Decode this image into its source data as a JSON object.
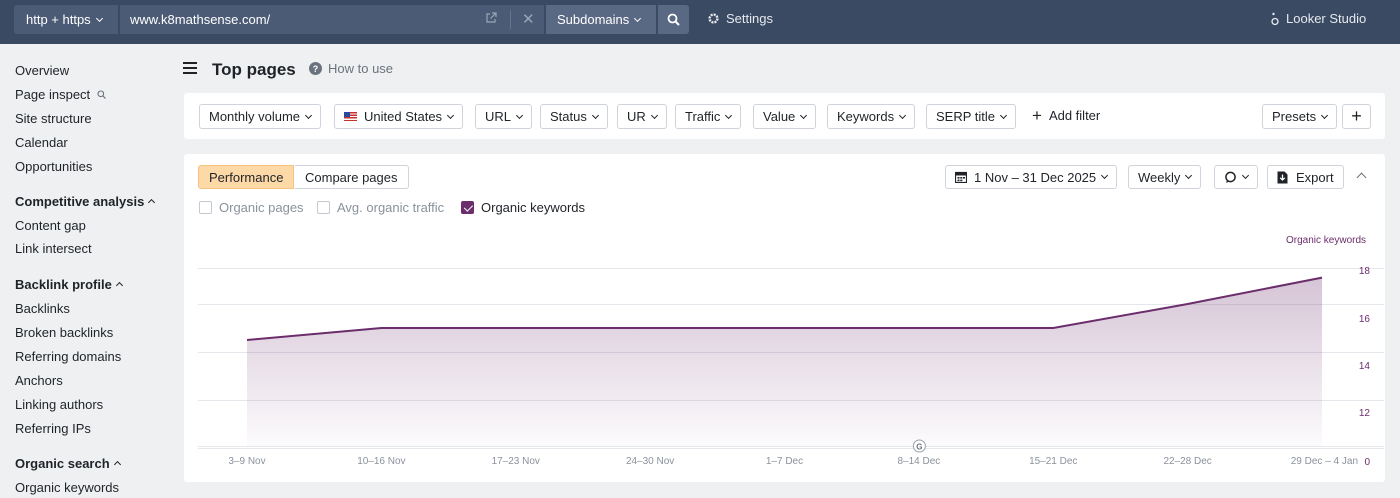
{
  "topbar": {
    "protocol": "http + https",
    "url": "www.k8mathsense.com/",
    "mode": "Subdomains",
    "settings_label": "Settings",
    "looker_label": "Looker Studio"
  },
  "sidebar": {
    "items_top": [
      "Overview",
      "Page inspect",
      "Site structure",
      "Calendar",
      "Opportunities"
    ],
    "competitive_head": "Competitive analysis",
    "competitive_items": [
      "Content gap",
      "Link intersect"
    ],
    "backlink_head": "Backlink profile",
    "backlink_items": [
      "Backlinks",
      "Broken backlinks",
      "Referring domains",
      "Anchors",
      "Linking authors",
      "Referring IPs"
    ],
    "organic_head": "Organic search",
    "organic_items": [
      "Organic keywords"
    ]
  },
  "header": {
    "title": "Top pages",
    "how_to": "How to use"
  },
  "filters": {
    "items": [
      "Monthly volume",
      "United States",
      "URL",
      "Status",
      "UR",
      "Traffic",
      "Value",
      "Keywords",
      "SERP title"
    ],
    "add_filter": "Add filter",
    "presets": "Presets",
    "plus": "+"
  },
  "panel": {
    "tab_performance": "Performance",
    "tab_compare": "Compare pages",
    "date_range": "1 Nov – 31 Dec 2025",
    "interval": "Weekly",
    "export": "Export",
    "legend": [
      "Organic pages",
      "Avg. organic traffic",
      "Organic keywords"
    ],
    "legend_checked": [
      false,
      false,
      true
    ]
  },
  "colors": {
    "accent": "#6b2d6b",
    "topbar": "#3a4a63",
    "active_tab": "#fdd9a8"
  },
  "chart_data": {
    "type": "area",
    "series": [
      {
        "name": "Organic keywords",
        "values": [
          15.5,
          16,
          16,
          16,
          16,
          16,
          16,
          17,
          18.1
        ]
      }
    ],
    "categories": [
      "3–9 Nov",
      "10–16 Nov",
      "17–23 Nov",
      "24–30 Nov",
      "1–7 Dec",
      "8–14 Dec",
      "15–21 Dec",
      "22–28 Dec",
      "29 Dec – 4 Jan"
    ],
    "y_ticks": [
      "18",
      "16",
      "14",
      "12",
      "0"
    ],
    "ylabel": "Organic keywords",
    "color": "#6b2d6b",
    "grid": true,
    "annotation": "G"
  }
}
